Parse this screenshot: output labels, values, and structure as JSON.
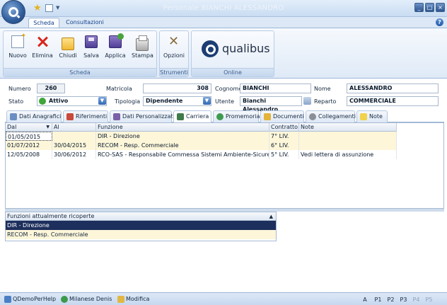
{
  "window": {
    "title": "Personale BIANCHI ALESSANDRO",
    "controls": [
      "_",
      "□",
      "×"
    ]
  },
  "ribbon_tabs": [
    "Scheda",
    "Consultazioni"
  ],
  "ribbon": {
    "scheda_buttons": [
      "Nuovo",
      "Elimina",
      "Chiudi",
      "Salva",
      "Applica",
      "Stampa"
    ],
    "scheda_label": "Scheda",
    "strumenti_buttons": [
      "Opzioni"
    ],
    "strumenti_label": "Strumenti",
    "online_label": "Online",
    "logo_text": "qualibus"
  },
  "form": {
    "numero_label": "Numero",
    "numero": "260",
    "matricola_label": "Matricola",
    "matricola": "308",
    "cognome_label": "Cognome",
    "cognome": "BIANCHI",
    "nome_label": "Nome",
    "nome": "ALESSANDRO",
    "stato_label": "Stato",
    "stato": "Attivo",
    "tipologia_label": "Tipologia",
    "tipologia": "Dipendente",
    "utente_label": "Utente",
    "utente": "Bianchi Alessandro",
    "reparto_label": "Reparto",
    "reparto": "COMMERCIALE"
  },
  "detail_tabs": [
    "Dati Anagrafici",
    "Riferimenti",
    "Dati Personalizzati",
    "Carriera",
    "Promemoria",
    "Documenti",
    "Collegamenti",
    "Note"
  ],
  "grid": {
    "columns": [
      "Dal",
      "Al",
      "Funzione",
      "Contratto",
      "Note"
    ],
    "rows": [
      [
        "01/05/2015",
        "",
        "DIR - Direzione",
        "7° LIV.",
        ""
      ],
      [
        "01/07/2012",
        "30/04/2015",
        "RECOM - Resp. Commerciale",
        "6° LIV.",
        ""
      ],
      [
        "12/05/2008",
        "30/06/2012",
        "RCO-SAS - Responsabile Commessa Sistemi Ambiente-Sicurezza",
        "5° LIV.",
        "Vedi lettera di assunzione"
      ]
    ]
  },
  "functions_list": {
    "header": "Funzioni attualmente ricoperte",
    "items": [
      "DIR - Direzione",
      "RECOM - Resp. Commerciale"
    ]
  },
  "statusbar": {
    "items": [
      "QDemoPerHelp",
      "Milanese Denis",
      "Modifica"
    ],
    "right": [
      "A",
      "P1",
      "P2",
      "P3",
      "P4",
      "P5"
    ]
  }
}
